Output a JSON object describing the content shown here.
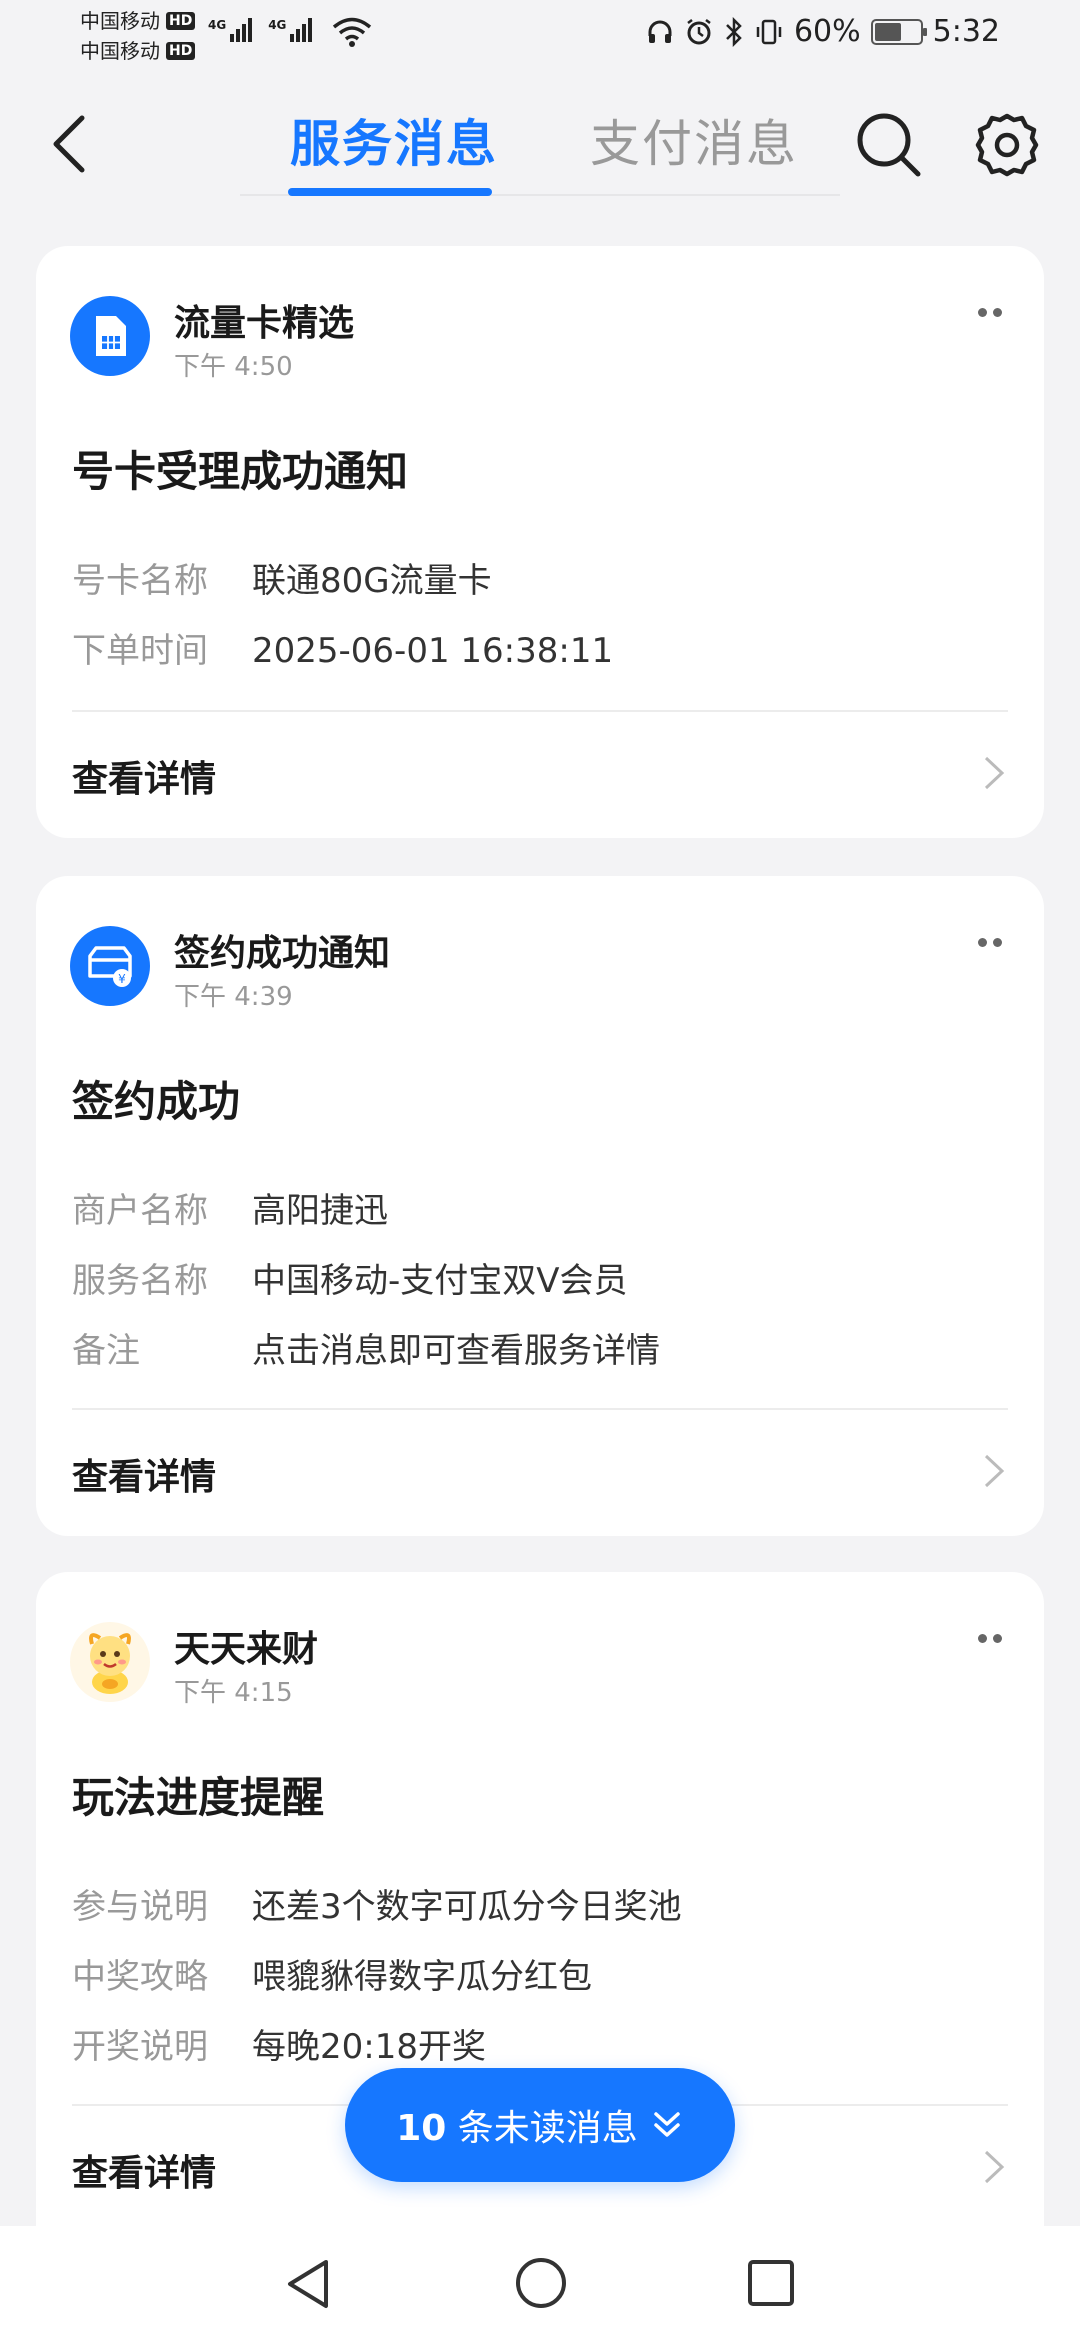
{
  "status": {
    "carrier1": "中国移动",
    "carrier2": "中国移动",
    "hd": "HD",
    "net1": "4G",
    "net2": "4G",
    "battery_pct": "60%",
    "battery_level": 0.6,
    "time": "5:32"
  },
  "header": {
    "tab_service": "服务消息",
    "tab_pay": "支付消息"
  },
  "cards": [
    {
      "source": "流量卡精选",
      "time": "下午 4:50",
      "title": "号卡受理成功通知",
      "rows": [
        {
          "k": "号卡名称",
          "v": "联通80G流量卡"
        },
        {
          "k": "下单时间",
          "v": "2025-06-01 16:38:11"
        }
      ],
      "detail": "查看详情"
    },
    {
      "source": "签约成功通知",
      "time": "下午 4:39",
      "title": "签约成功",
      "rows": [
        {
          "k": "商户名称",
          "v": "高阳捷迅"
        },
        {
          "k": "服务名称",
          "v": "中国移动-支付宝双V会员"
        },
        {
          "k": "备注",
          "v": "点击消息即可查看服务详情"
        }
      ],
      "detail": "查看详情"
    },
    {
      "source": "天天来财",
      "time": "下午 4:15",
      "title": "玩法进度提醒",
      "rows": [
        {
          "k": "参与说明",
          "v": "还差3个数字可瓜分今日奖池"
        },
        {
          "k": "中奖攻略",
          "v": "喂貔貅得数字瓜分红包"
        },
        {
          "k": "开奖说明",
          "v": "每晚20:18开奖"
        }
      ],
      "detail": "查看详情"
    }
  ],
  "unread": {
    "count": "10",
    "label": "条未读消息"
  },
  "colors": {
    "accent": "#1677ff",
    "background": "#f3f3f5"
  },
  "icons": [
    "back-arrow-icon",
    "search-icon",
    "gear-icon",
    "sim-card-icon",
    "contract-icon",
    "mascot-icon",
    "more-icon",
    "chevron-right-icon",
    "double-chevron-down-icon"
  ]
}
